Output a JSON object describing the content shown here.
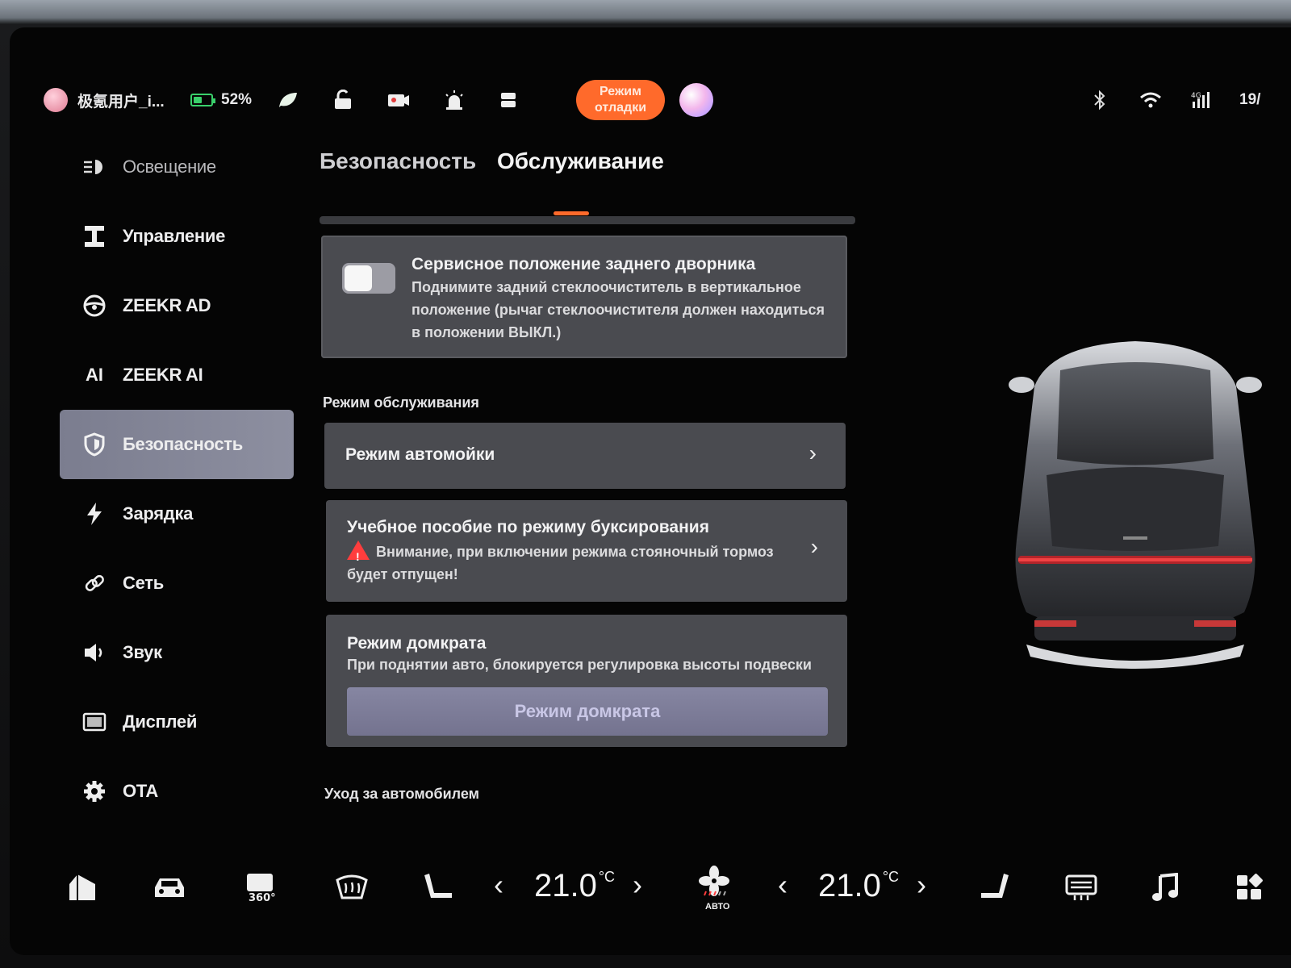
{
  "status": {
    "user": "极氪用户_i...",
    "battery_percent": 52,
    "battery_text": "52%",
    "debug_badge": "Режим отладки",
    "time": "19/",
    "icons": [
      "leaf-icon",
      "lock-open-icon",
      "camera-icon",
      "alarm-icon",
      "seat-icon",
      "bluetooth-icon",
      "wifi-icon",
      "cellular-4g-icon"
    ],
    "accent_color": "#ff6a2b"
  },
  "sidebar": {
    "items": [
      {
        "label": "Освещение",
        "icon": "light-icon"
      },
      {
        "label": "Управление",
        "icon": "steering-control-icon"
      },
      {
        "label": "ZEEKR AD",
        "icon": "steering-wheel-icon"
      },
      {
        "label": "ZEEKR AI",
        "icon": "ai-icon"
      },
      {
        "label": "Безопасность",
        "icon": "shield-icon"
      },
      {
        "label": "Зарядка",
        "icon": "bolt-icon"
      },
      {
        "label": "Сеть",
        "icon": "link-icon"
      },
      {
        "label": "Звук",
        "icon": "speaker-icon"
      },
      {
        "label": "Дисплей",
        "icon": "display-icon"
      },
      {
        "label": "OTA",
        "icon": "gear-icon"
      }
    ],
    "active_index": 4
  },
  "tabs": [
    {
      "label": "Безопасность"
    },
    {
      "label": "Обслуживание"
    }
  ],
  "active_tab": 1,
  "main": {
    "wiper": {
      "title": "Сервисное положение заднего дворника",
      "desc": "Поднимите задний стеклоочиститель в вертикальное положение (рычаг стеклоочистителя должен находиться в положении ВЫКЛ.)",
      "toggle_on": false
    },
    "service_label": "Режим обслуживания",
    "carwash": {
      "title": "Режим автомойки"
    },
    "towing": {
      "title": "Учебное пособие по режиму буксирования",
      "warning": "Внимание, при включении режима стояночный тормоз будет отпущен!"
    },
    "jack": {
      "title": "Режим домкрата",
      "desc": "При поднятии авто, блокируется регулировка высоты подвески",
      "button": "Режим домкрата"
    },
    "care_label": "Уход за автомобилем"
  },
  "dock": {
    "left_temp": "21.0",
    "right_temp": "21.0",
    "unit": "°C",
    "fan_label": "АВТО",
    "icons": [
      "home-icon",
      "car-icon",
      "camera-360-icon",
      "defrost-front-icon",
      "seat-left-icon",
      "fan-icon",
      "seat-right-icon",
      "defrost-rear-icon",
      "music-icon",
      "apps-icon"
    ]
  }
}
